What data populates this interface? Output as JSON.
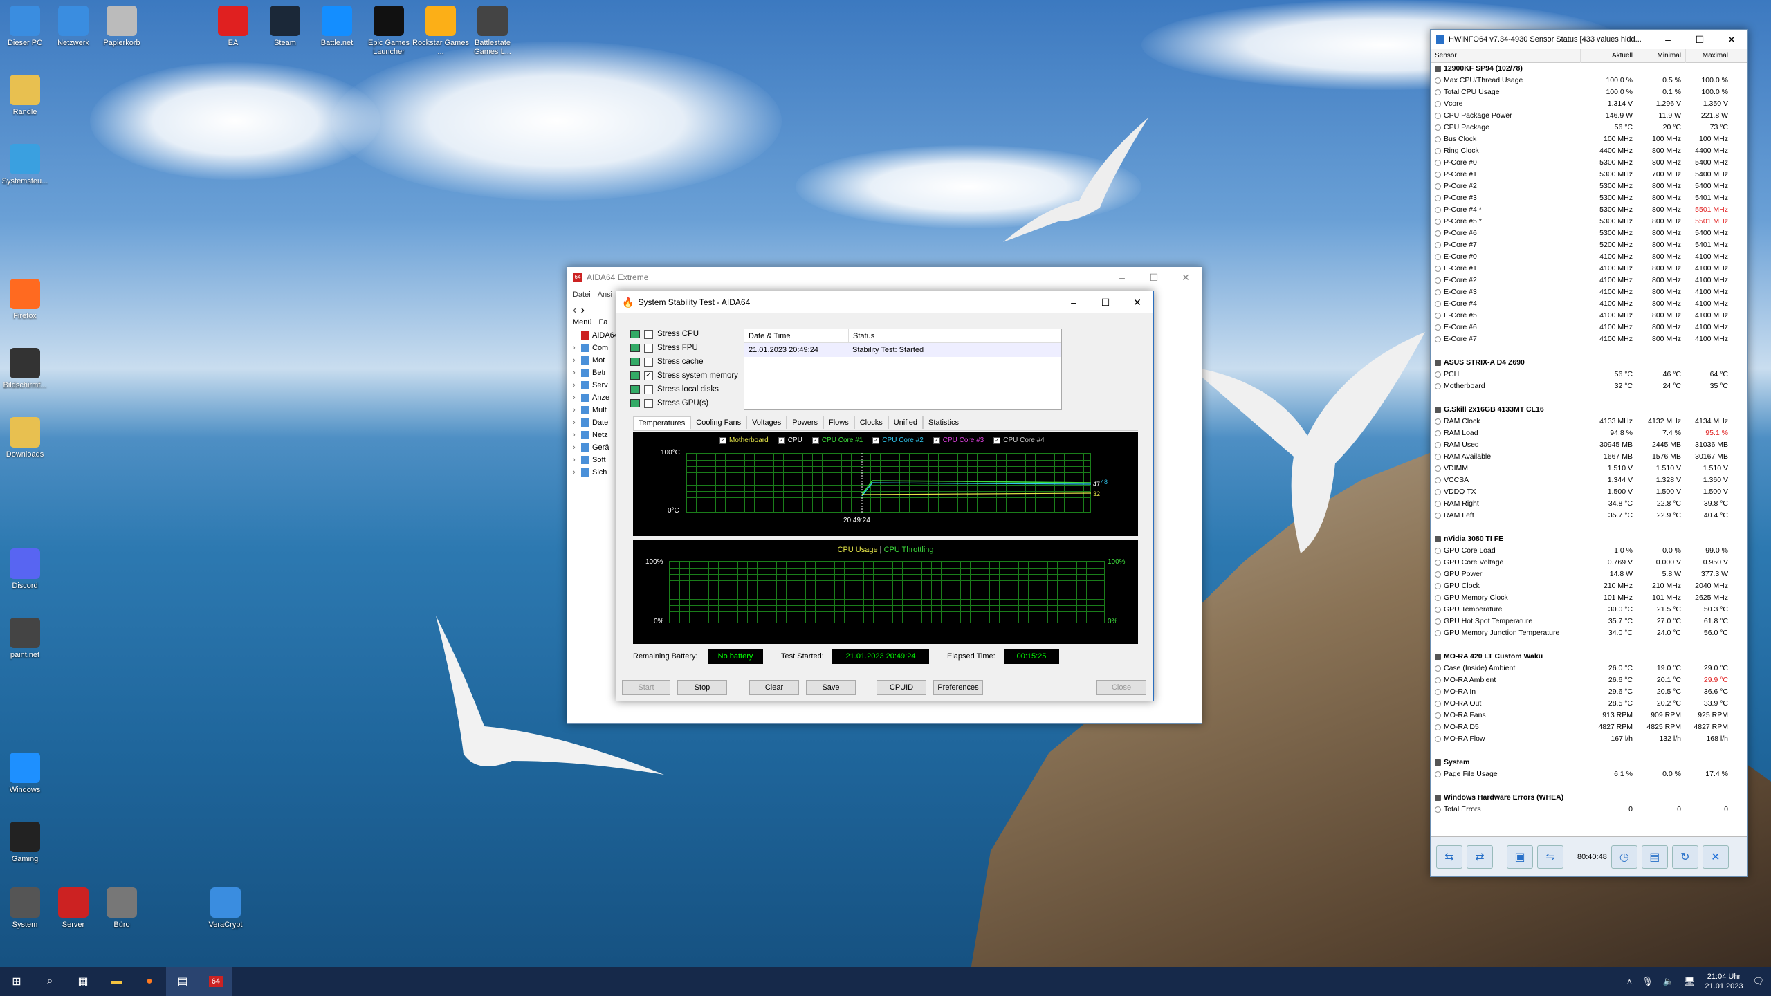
{
  "desktop": {
    "icons_left": [
      {
        "label": "Dieser PC",
        "icon": "pc-icon"
      },
      {
        "label": "Netzwerk",
        "icon": "network-icon"
      },
      {
        "label": "Papierkorb",
        "icon": "recycle-bin-icon"
      },
      {
        "label": "Randle",
        "icon": "user-folder-icon"
      },
      {
        "label": "Systemsteu...",
        "icon": "control-panel-icon"
      },
      {
        "label": "Firefox",
        "icon": "firefox-icon"
      },
      {
        "label": "Bildschirmf...",
        "icon": "screenshot-icon"
      },
      {
        "label": "Downloads",
        "icon": "downloads-icon"
      },
      {
        "label": "Discord",
        "icon": "discord-icon"
      },
      {
        "label": "paint.net",
        "icon": "paintnet-icon"
      },
      {
        "label": "Windows",
        "icon": "windows-icon"
      },
      {
        "label": "Gaming",
        "icon": "gaming-icon"
      },
      {
        "label": "System",
        "icon": "gear-icon"
      },
      {
        "label": "Server",
        "icon": "server-icon"
      },
      {
        "label": "Büro",
        "icon": "office-icon"
      },
      {
        "label": "VeraCrypt",
        "icon": "veracrypt-icon"
      }
    ],
    "icons_top": [
      {
        "label": "EA",
        "icon": "ea-icon"
      },
      {
        "label": "Steam",
        "icon": "steam-icon"
      },
      {
        "label": "Battle.net",
        "icon": "battlenet-icon"
      },
      {
        "label": "Epic Games Launcher",
        "icon": "epic-icon"
      },
      {
        "label": "Rockstar Games ...",
        "icon": "rockstar-icon"
      },
      {
        "label": "Battlestate Games L...",
        "icon": "battlestate-icon"
      }
    ]
  },
  "hwinfo": {
    "title": "HWiNFO64 v7.34-4930 Sensor Status [433 values hidd...",
    "cols": [
      "Sensor",
      "Aktuell",
      "Minimal",
      "Maximal"
    ],
    "rows": [
      {
        "g": "12900KF SP94 (102/78)"
      },
      {
        "n": "Max CPU/Thread Usage",
        "a": "100.0 %",
        "mi": "0.5 %",
        "ma": "100.0 %"
      },
      {
        "n": "Total CPU Usage",
        "a": "100.0 %",
        "mi": "0.1 %",
        "ma": "100.0 %"
      },
      {
        "n": "Vcore",
        "a": "1.314 V",
        "mi": "1.296 V",
        "ma": "1.350 V"
      },
      {
        "n": "CPU Package Power",
        "a": "146.9 W",
        "mi": "11.9 W",
        "ma": "221.8 W"
      },
      {
        "n": "CPU Package",
        "a": "56 °C",
        "mi": "20 °C",
        "ma": "73 °C"
      },
      {
        "n": "Bus Clock",
        "a": "100 MHz",
        "mi": "100 MHz",
        "ma": "100 MHz"
      },
      {
        "n": "Ring Clock",
        "a": "4400 MHz",
        "mi": "800 MHz",
        "ma": "4400 MHz"
      },
      {
        "n": "P-Core #0",
        "a": "5300 MHz",
        "mi": "800 MHz",
        "ma": "5400 MHz"
      },
      {
        "n": "P-Core #1",
        "a": "5300 MHz",
        "mi": "700 MHz",
        "ma": "5400 MHz"
      },
      {
        "n": "P-Core #2",
        "a": "5300 MHz",
        "mi": "800 MHz",
        "ma": "5400 MHz"
      },
      {
        "n": "P-Core #3",
        "a": "5300 MHz",
        "mi": "800 MHz",
        "ma": "5401 MHz"
      },
      {
        "n": "P-Core #4 *",
        "a": "5300 MHz",
        "mi": "800 MHz",
        "ma": "5501 MHz",
        "r": true
      },
      {
        "n": "P-Core #5 *",
        "a": "5300 MHz",
        "mi": "800 MHz",
        "ma": "5501 MHz",
        "r": true
      },
      {
        "n": "P-Core #6",
        "a": "5300 MHz",
        "mi": "800 MHz",
        "ma": "5400 MHz"
      },
      {
        "n": "P-Core #7",
        "a": "5200 MHz",
        "mi": "800 MHz",
        "ma": "5401 MHz"
      },
      {
        "n": "E-Core #0",
        "a": "4100 MHz",
        "mi": "800 MHz",
        "ma": "4100 MHz"
      },
      {
        "n": "E-Core #1",
        "a": "4100 MHz",
        "mi": "800 MHz",
        "ma": "4100 MHz"
      },
      {
        "n": "E-Core #2",
        "a": "4100 MHz",
        "mi": "800 MHz",
        "ma": "4100 MHz"
      },
      {
        "n": "E-Core #3",
        "a": "4100 MHz",
        "mi": "800 MHz",
        "ma": "4100 MHz"
      },
      {
        "n": "E-Core #4",
        "a": "4100 MHz",
        "mi": "800 MHz",
        "ma": "4100 MHz"
      },
      {
        "n": "E-Core #5",
        "a": "4100 MHz",
        "mi": "800 MHz",
        "ma": "4100 MHz"
      },
      {
        "n": "E-Core #6",
        "a": "4100 MHz",
        "mi": "800 MHz",
        "ma": "4100 MHz"
      },
      {
        "n": "E-Core #7",
        "a": "4100 MHz",
        "mi": "800 MHz",
        "ma": "4100 MHz"
      },
      {
        "gap": true
      },
      {
        "g": "ASUS STRIX-A D4 Z690"
      },
      {
        "n": "PCH",
        "a": "56 °C",
        "mi": "46 °C",
        "ma": "64 °C"
      },
      {
        "n": "Motherboard",
        "a": "32 °C",
        "mi": "24 °C",
        "ma": "35 °C"
      },
      {
        "gap": true
      },
      {
        "g": "G.Skill 2x16GB 4133MT CL16"
      },
      {
        "n": "RAM Clock",
        "a": "4133 MHz",
        "mi": "4132 MHz",
        "ma": "4134 MHz"
      },
      {
        "n": "RAM Load",
        "a": "94.8 %",
        "mi": "7.4 %",
        "ma": "95.1 %",
        "r": true
      },
      {
        "n": "RAM Used",
        "a": "30945 MB",
        "mi": "2445 MB",
        "ma": "31036 MB"
      },
      {
        "n": "RAM Available",
        "a": "1667 MB",
        "mi": "1576 MB",
        "ma": "30167 MB"
      },
      {
        "n": "VDIMM",
        "a": "1.510 V",
        "mi": "1.510 V",
        "ma": "1.510 V"
      },
      {
        "n": "VCCSA",
        "a": "1.344 V",
        "mi": "1.328 V",
        "ma": "1.360 V"
      },
      {
        "n": "VDDQ TX",
        "a": "1.500 V",
        "mi": "1.500 V",
        "ma": "1.500 V"
      },
      {
        "n": "RAM Right",
        "a": "34.8 °C",
        "mi": "22.8 °C",
        "ma": "39.8 °C"
      },
      {
        "n": "RAM Left",
        "a": "35.7 °C",
        "mi": "22.9 °C",
        "ma": "40.4 °C"
      },
      {
        "gap": true
      },
      {
        "g": "nVidia 3080 TI FE"
      },
      {
        "n": "GPU Core Load",
        "a": "1.0 %",
        "mi": "0.0 %",
        "ma": "99.0 %"
      },
      {
        "n": "GPU Core Voltage",
        "a": "0.769 V",
        "mi": "0.000 V",
        "ma": "0.950 V"
      },
      {
        "n": "GPU Power",
        "a": "14.8 W",
        "mi": "5.8 W",
        "ma": "377.3 W"
      },
      {
        "n": "GPU Clock",
        "a": "210 MHz",
        "mi": "210 MHz",
        "ma": "2040 MHz"
      },
      {
        "n": "GPU Memory Clock",
        "a": "101 MHz",
        "mi": "101 MHz",
        "ma": "2625 MHz"
      },
      {
        "n": "GPU Temperature",
        "a": "30.0 °C",
        "mi": "21.5 °C",
        "ma": "50.3 °C"
      },
      {
        "n": "GPU Hot Spot Temperature",
        "a": "35.7 °C",
        "mi": "27.0 °C",
        "ma": "61.8 °C"
      },
      {
        "n": "GPU Memory Junction Temperature",
        "a": "34.0 °C",
        "mi": "24.0 °C",
        "ma": "56.0 °C"
      },
      {
        "gap": true
      },
      {
        "g": "MO-RA 420 LT Custom Wakü"
      },
      {
        "n": "Case (Inside) Ambient",
        "a": "26.0 °C",
        "mi": "19.0 °C",
        "ma": "29.0 °C"
      },
      {
        "n": "MO-RA Ambient",
        "a": "26.6 °C",
        "mi": "20.1 °C",
        "ma": "29.9 °C",
        "r": true
      },
      {
        "n": "MO-RA In",
        "a": "29.6 °C",
        "mi": "20.5 °C",
        "ma": "36.6 °C"
      },
      {
        "n": "MO-RA Out",
        "a": "28.5 °C",
        "mi": "20.2 °C",
        "ma": "33.9 °C"
      },
      {
        "n": "MO-RA Fans",
        "a": "913 RPM",
        "mi": "909 RPM",
        "ma": "925 RPM"
      },
      {
        "n": "MO-RA D5",
        "a": "4827 RPM",
        "mi": "4825 RPM",
        "ma": "4827 RPM"
      },
      {
        "n": "MO-RA Flow",
        "a": "167 l/h",
        "mi": "132 l/h",
        "ma": "168 l/h"
      },
      {
        "gap": true
      },
      {
        "g": "System"
      },
      {
        "n": "Page File Usage",
        "a": "6.1 %",
        "mi": "0.0 %",
        "ma": "17.4 %"
      },
      {
        "gap": true
      },
      {
        "g": "Windows Hardware Errors (WHEA)"
      },
      {
        "n": "Total Errors",
        "a": "0",
        "mi": "0",
        "ma": "0"
      }
    ],
    "timer": "80:40:48"
  },
  "aida": {
    "title": "AIDA64 Extreme",
    "menu": [
      "Datei",
      "Ansi"
    ],
    "side_tabs": [
      "Menü",
      "Fa"
    ],
    "tree": [
      "AIDA64",
      "Com",
      "Mot",
      "Betr",
      "Serv",
      "Anze",
      "Mult",
      "Date",
      "Netz",
      "Gerä",
      "Soft",
      "Sich"
    ]
  },
  "sst": {
    "title": "System Stability Test - AIDA64",
    "checks": [
      {
        "label": "Stress CPU",
        "on": false
      },
      {
        "label": "Stress FPU",
        "on": false
      },
      {
        "label": "Stress cache",
        "on": false
      },
      {
        "label": "Stress system memory",
        "on": true
      },
      {
        "label": "Stress local disks",
        "on": false
      },
      {
        "label": "Stress GPU(s)",
        "on": false
      }
    ],
    "log_cols": [
      "Date & Time",
      "Status"
    ],
    "log_rows": [
      {
        "dt": "21.01.2023 20:49:24",
        "st": "Stability Test: Started"
      }
    ],
    "tabs": [
      "Temperatures",
      "Cooling Fans",
      "Voltages",
      "Powers",
      "Flows",
      "Clocks",
      "Unified",
      "Statistics"
    ],
    "legend": [
      {
        "label": "Motherboard",
        "color": "#e8e84a"
      },
      {
        "label": "CPU",
        "color": "#ffffff"
      },
      {
        "label": "CPU Core #1",
        "color": "#3ee03e"
      },
      {
        "label": "CPU Core #2",
        "color": "#30c8f0"
      },
      {
        "label": "CPU Core #3",
        "color": "#e040e0"
      },
      {
        "label": "CPU Core #4",
        "color": "#d0d0d0"
      }
    ],
    "temp_top": "100°C",
    "temp_bottom": "0°C",
    "temp_time": "20:49:24",
    "temp_vals": [
      "47",
      "48",
      "32"
    ],
    "usage_title_a": "CPU Usage",
    "usage_sep": "|",
    "usage_title_b": "CPU Throttling",
    "usage_top": "100%",
    "usage_bottom": "0%",
    "remaining_label": "Remaining Battery:",
    "remaining": "No battery",
    "started_label": "Test Started:",
    "started": "21.01.2023 20:49:24",
    "elapsed_label": "Elapsed Time:",
    "elapsed": "00:15:25",
    "buttons": {
      "start": "Start",
      "stop": "Stop",
      "clear": "Clear",
      "save": "Save",
      "cpuid": "CPUID",
      "prefs": "Preferences",
      "close": "Close"
    }
  },
  "taskbar": {
    "time": "21:04 Uhr",
    "date": "21.01.2023",
    "app64": "64"
  }
}
